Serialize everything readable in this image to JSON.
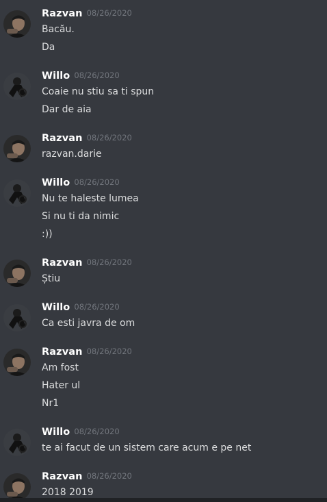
{
  "colors": {
    "background": "#36393f",
    "username": "#ffffff",
    "timestamp": "#72767d",
    "text": "#dcddde"
  },
  "messages": [
    {
      "author": "Razvan",
      "time": "08/26/2020",
      "avatar": "razvan-avatar-icon",
      "lines": [
        "Bacău.",
        "Da"
      ]
    },
    {
      "author": "Willo",
      "time": "08/26/2020",
      "avatar": "willo-avatar-icon",
      "lines": [
        "Coaie nu stiu sa ti spun",
        "Dar de aia"
      ]
    },
    {
      "author": "Razvan",
      "time": "08/26/2020",
      "avatar": "razvan-avatar-icon",
      "lines": [
        "razvan.darie"
      ]
    },
    {
      "author": "Willo",
      "time": "08/26/2020",
      "avatar": "willo-avatar-icon",
      "lines": [
        "Nu te haleste lumea",
        "Si nu ti da nimic",
        ":))"
      ]
    },
    {
      "author": "Razvan",
      "time": "08/26/2020",
      "avatar": "razvan-avatar-icon",
      "lines": [
        "Știu"
      ]
    },
    {
      "author": "Willo",
      "time": "08/26/2020",
      "avatar": "willo-avatar-icon",
      "lines": [
        "Ca esti javra de om"
      ]
    },
    {
      "author": "Razvan",
      "time": "08/26/2020",
      "avatar": "razvan-avatar-icon",
      "lines": [
        "Am fost",
        "Hater ul",
        "Nr1"
      ]
    },
    {
      "author": "Willo",
      "time": "08/26/2020",
      "avatar": "willo-avatar-icon",
      "lines": [
        "te ai facut de un sistem care acum e pe net"
      ]
    },
    {
      "author": "Razvan",
      "time": "08/26/2020",
      "avatar": "razvan-avatar-icon",
      "lines": [
        "2018 2019"
      ]
    }
  ]
}
